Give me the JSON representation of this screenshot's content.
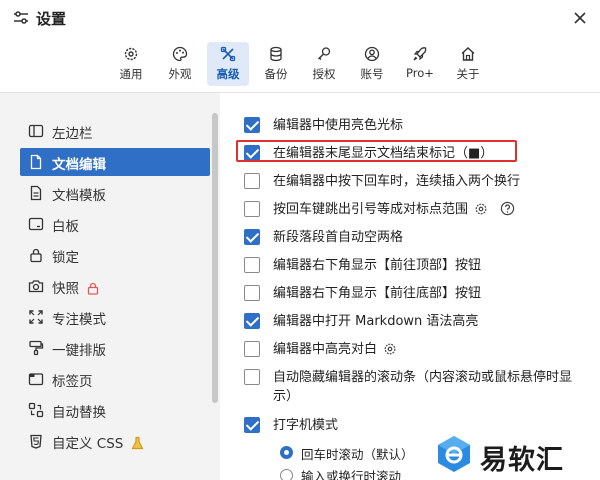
{
  "window": {
    "title": "设置",
    "title_icon": "sliders-icon",
    "close_icon": "close-icon"
  },
  "tabs": [
    {
      "label": "通用",
      "icon": "gear-icon"
    },
    {
      "label": "外观",
      "icon": "palette-icon"
    },
    {
      "label": "高级",
      "icon": "tools-icon",
      "active": true
    },
    {
      "label": "备份",
      "icon": "database-icon"
    },
    {
      "label": "授权",
      "icon": "key-icon"
    },
    {
      "label": "账号",
      "icon": "user-icon"
    },
    {
      "label": "Pro+",
      "icon": "rocket-icon"
    },
    {
      "label": "关于",
      "icon": "home-icon"
    }
  ],
  "sidebar": {
    "items": [
      {
        "label": "左边栏",
        "icon": "sidebar-icon"
      },
      {
        "label": "文档编辑",
        "icon": "document-icon",
        "active": true
      },
      {
        "label": "文档模板",
        "icon": "template-icon"
      },
      {
        "label": "白板",
        "icon": "whiteboard-icon"
      },
      {
        "label": "锁定",
        "icon": "lock-icon"
      },
      {
        "label": "快照",
        "icon": "camera-icon",
        "badge": "lock-badge-icon"
      },
      {
        "label": "专注模式",
        "icon": "focus-icon"
      },
      {
        "label": "一键排版",
        "icon": "format-brush-icon"
      },
      {
        "label": "标签页",
        "icon": "tabs-icon"
      },
      {
        "label": "自动替换",
        "icon": "replace-icon"
      },
      {
        "label": "自定义 CSS",
        "icon": "css-icon",
        "badge": "flask-icon"
      }
    ]
  },
  "options": [
    {
      "label": "编辑器中使用亮色光标",
      "checked": true
    },
    {
      "label": "在编辑器末尾显示文档结束标记（■）",
      "checked": true
    },
    {
      "label": "在编辑器中按下回车时，连续插入两个换行",
      "checked": false
    },
    {
      "label": "按回车键跳出引号等成对标点范围",
      "checked": false,
      "extra_icons": [
        "gear-icon",
        "help-icon"
      ]
    },
    {
      "label": "新段落段首自动空两格",
      "checked": true
    },
    {
      "label": "编辑器右下角显示【前往顶部】按钮",
      "checked": false
    },
    {
      "label": "编辑器右下角显示【前往底部】按钮",
      "checked": false
    },
    {
      "label": "编辑器中打开 Markdown 语法高亮",
      "checked": true
    },
    {
      "label": "编辑器中高亮对白",
      "checked": false,
      "extra_icons": [
        "gear-icon"
      ]
    },
    {
      "label": "自动隐藏编辑器的滚动条（内容滚动或鼠标悬停时显示）",
      "checked": false
    },
    {
      "label": "打字机模式",
      "checked": true
    }
  ],
  "typewriter_modes": [
    {
      "label": "回车时滚动（默认）",
      "selected": true
    },
    {
      "label": "输入或换行时滚动",
      "selected": false
    }
  ],
  "watermark": {
    "text": "易软汇"
  },
  "colors": {
    "accent": "#2f6fc6",
    "highlight_box": "#e03030",
    "sidebar_bg": "#f3f3f3"
  }
}
